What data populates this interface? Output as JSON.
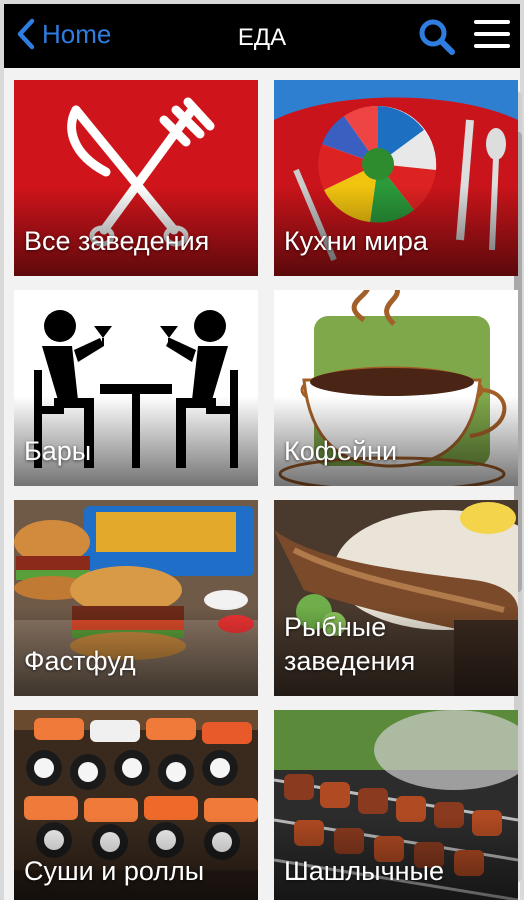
{
  "header": {
    "back_label": "Home",
    "title": "ЕДА"
  },
  "icons": {
    "back": "chevron-left-icon",
    "search": "search-icon",
    "menu": "hamburger-menu-icon"
  },
  "colors": {
    "topbar": "#000000",
    "accent": "#2f7de1",
    "tile_red": "#d0141b"
  },
  "tiles": [
    {
      "label": "Все заведения"
    },
    {
      "label": "Кухни мира"
    },
    {
      "label": "Бары"
    },
    {
      "label": "Кофейни"
    },
    {
      "label": "Фастфуд"
    },
    {
      "label": "Рыбные заведения"
    },
    {
      "label": "Суши и роллы"
    },
    {
      "label": "Шашлычные"
    }
  ]
}
